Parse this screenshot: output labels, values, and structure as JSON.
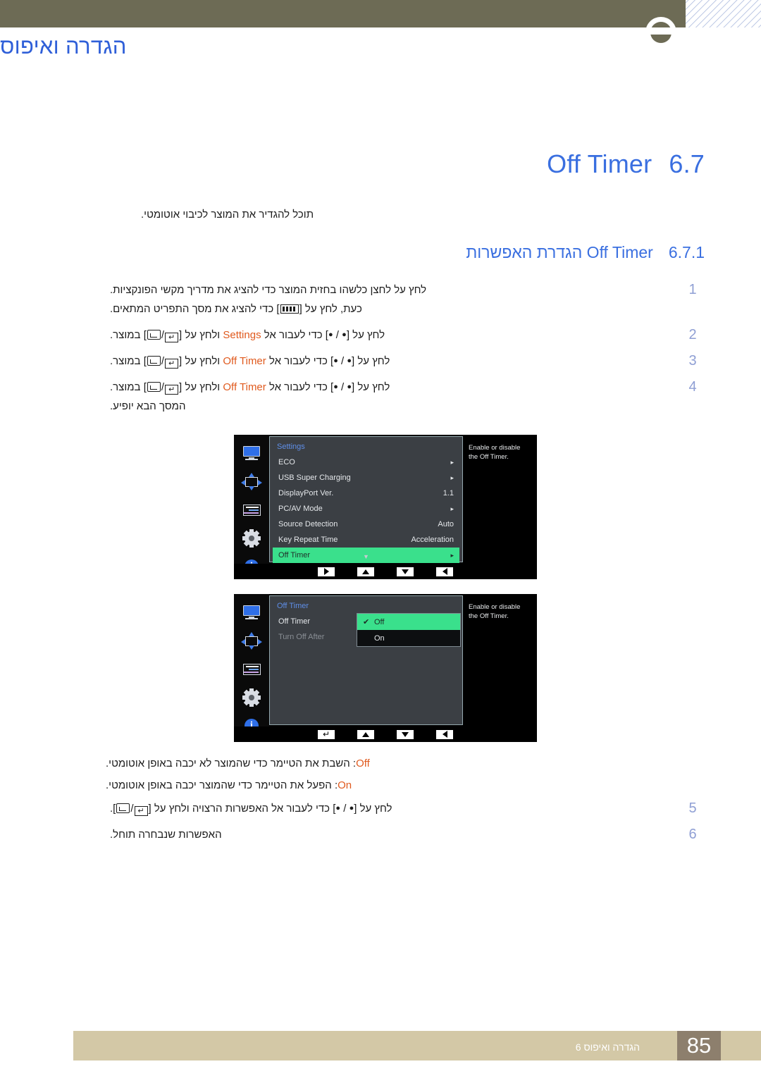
{
  "header": {
    "title": "הגדרה ואיפוס"
  },
  "section": {
    "number": "6.7",
    "title": "Off Timer",
    "intro": "תוכל להגדיר את המוצר לכיבוי אוטומטי."
  },
  "subsection": {
    "number": "6.7.1",
    "title": "הגדרת האפשרות Off Timer"
  },
  "steps": [
    {
      "num": "1",
      "line1_a": "לחץ על לחצן כלשהו בחזית המוצר כדי להציג את מדריך מקשי הפונקציות.",
      "line2_a": "כעת, לחץ על [",
      "line2_b": "] כדי להציג את מסך התפריט המתאים."
    },
    {
      "num": "2",
      "a": "לחץ על [",
      "b": " / ",
      "c": "] כדי לעבור אל ",
      "target": "Settings",
      "d": " ולחץ על [",
      "e": "/",
      "f": "] במוצר."
    },
    {
      "num": "3",
      "a": "לחץ על [",
      "b": " / ",
      "c": "] כדי לעבור אל ",
      "target": "Off Timer",
      "d": " ולחץ על [",
      "e": "/",
      "f": "] במוצר."
    },
    {
      "num": "4",
      "a": "לחץ על [",
      "b": " / ",
      "c": "] כדי לעבור אל ",
      "target": "Off Timer",
      "d": " ולחץ על [",
      "e": "/",
      "f": "] במוצר.",
      "line2": "המסך הבא יופיע."
    }
  ],
  "steps2": [
    {
      "num": "5",
      "a": "לחץ על [",
      "b": " / ",
      "c": "] כדי לעבור אל האפשרות הרצויה ולחץ על [",
      "e": "/",
      "f": "]."
    },
    {
      "num": "6",
      "a": "האפשרות שנבחרה תוחל."
    }
  ],
  "notes": [
    {
      "label": "Off",
      "text": ": השבת את הטיימר כדי שהמוצר לא יכבה באופן אוטומטי."
    },
    {
      "label": "On",
      "text": ": הפעל את הטיימר כדי שהמוצר יכבה באופן אוטומטי."
    }
  ],
  "osd1": {
    "title": "Settings",
    "rows": [
      {
        "label": "ECO",
        "value": "",
        "caret": "▸",
        "state": "normal"
      },
      {
        "label": "USB Super Charging",
        "value": "",
        "caret": "▸",
        "state": "normal"
      },
      {
        "label": "DisplayPort Ver.",
        "value": "1.1",
        "caret": "",
        "state": "normal"
      },
      {
        "label": "PC/AV Mode",
        "value": "",
        "caret": "▸",
        "state": "normal"
      },
      {
        "label": "Source Detection",
        "value": "Auto",
        "caret": "",
        "state": "normal"
      },
      {
        "label": "Key Repeat Time",
        "value": "Acceleration",
        "caret": "",
        "state": "normal"
      },
      {
        "label": "Off Timer",
        "value": "",
        "caret": "▸",
        "state": "selected"
      }
    ],
    "scroll_indicator": "▼",
    "help": "Enable or disable the Off Timer.",
    "footer_buttons": [
      "left",
      "down",
      "up",
      "right"
    ]
  },
  "osd2": {
    "title": "Off Timer",
    "rows": [
      {
        "label": "Off Timer",
        "state": "normal"
      },
      {
        "label": "Turn Off After",
        "state": "dim"
      }
    ],
    "options": [
      {
        "label": "Off",
        "checked": "✔",
        "state": "selected"
      },
      {
        "label": "On",
        "checked": "",
        "state": "normal"
      }
    ],
    "help": "Enable or disable the Off Timer.",
    "footer_buttons": [
      "left",
      "down",
      "up",
      "enter"
    ]
  },
  "osd_rail_icons": [
    "monitor-icon",
    "move-icon",
    "osd-list-icon",
    "gear-icon",
    "info-icon"
  ],
  "info_icon_glyph": "i",
  "footer": {
    "chapter": "הגדרה ואיפוס 6",
    "page": "85"
  },
  "colors": {
    "accent_blue": "#3a6fe0",
    "highlight_orange": "#e05a1e",
    "osd_green": "#3ae08c",
    "header_olive": "#6d6b55",
    "footer_tan": "#d3c8a6",
    "footer_brown": "#8d7f6d"
  }
}
